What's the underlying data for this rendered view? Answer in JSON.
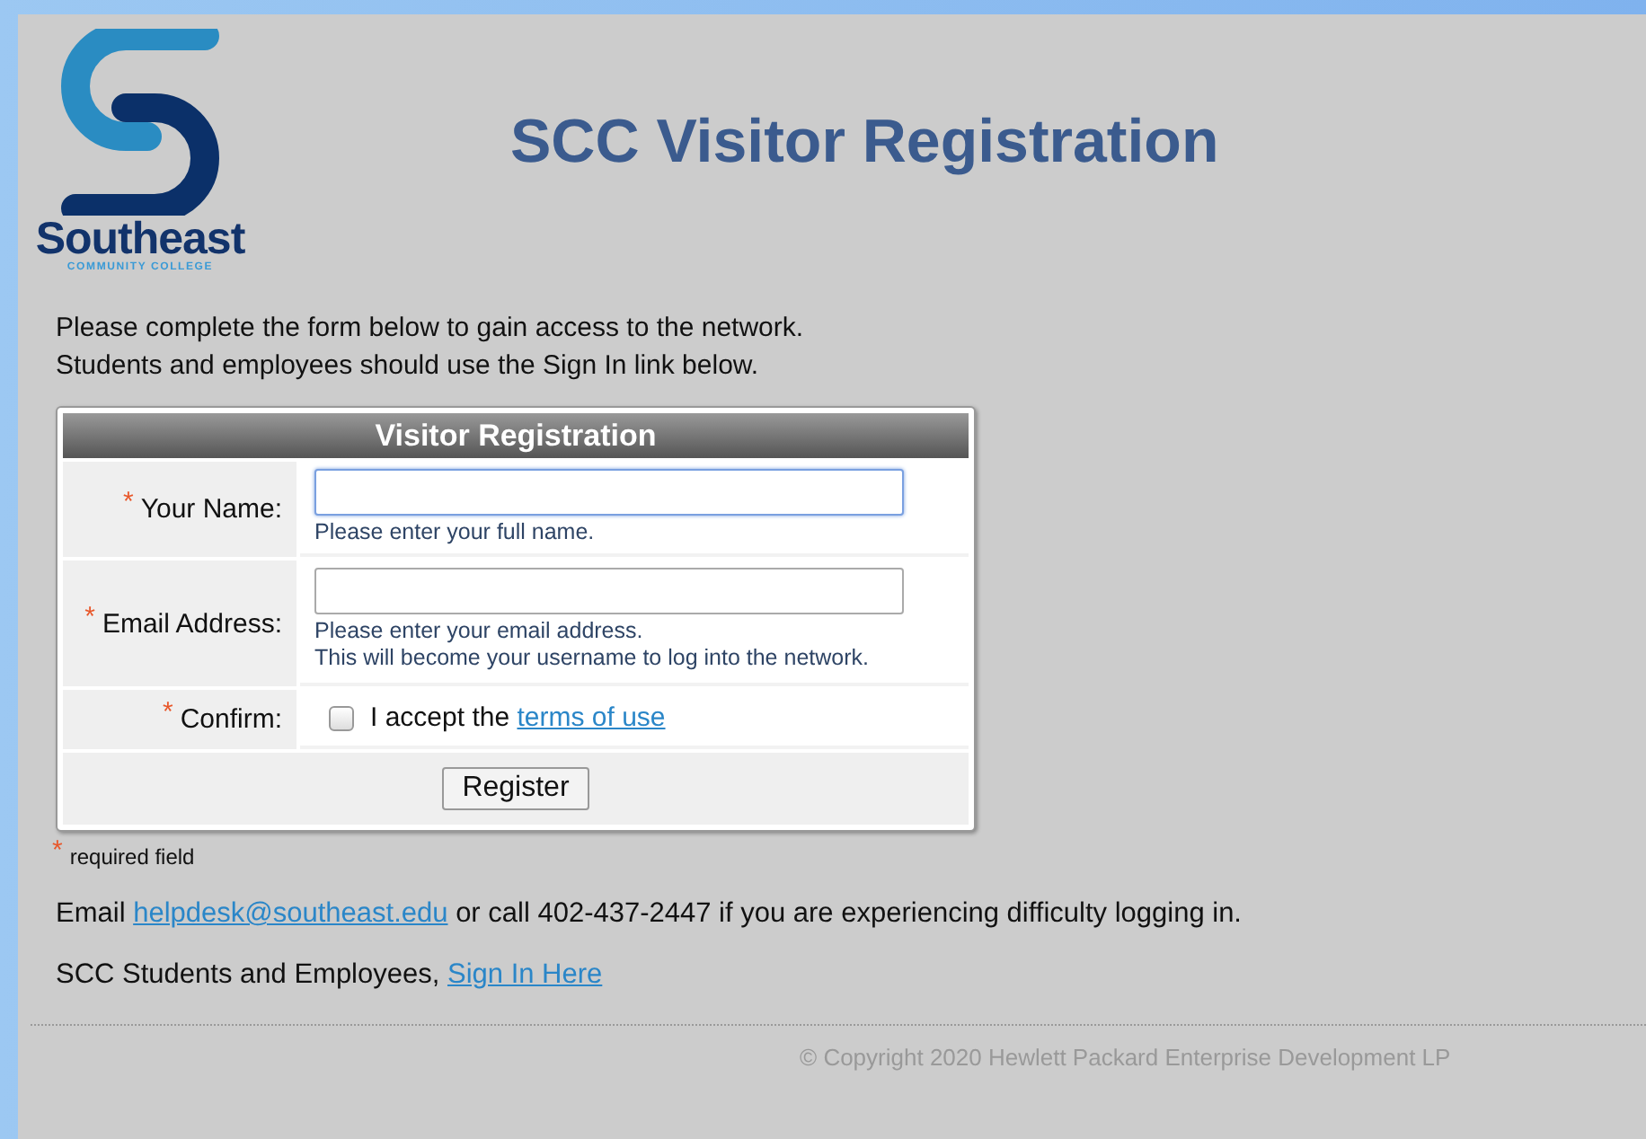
{
  "logo": {
    "name": "Southeast",
    "subtitle": "COMMUNITY COLLEGE"
  },
  "title": "SCC Visitor Registration",
  "intro": [
    "Please complete the form below to gain access to the network.",
    "Students and employees should use the Sign In link below."
  ],
  "form": {
    "title": "Visitor Registration",
    "fields": [
      {
        "kind": "text",
        "required_mark": "*",
        "label": "Your Name:",
        "focused": true,
        "hints": [
          "Please enter your full name."
        ]
      },
      {
        "kind": "text",
        "required_mark": "*",
        "label": "Email Address:",
        "focused": false,
        "hints": [
          "Please enter your email address.",
          "This will become your username to log into the network."
        ]
      },
      {
        "kind": "checkbox",
        "required_mark": "*",
        "label": "Confirm:",
        "checked": false,
        "text": "I accept the",
        "link": "terms of use"
      }
    ],
    "button": "Register"
  },
  "legend": {
    "mark": "*",
    "text": "required field"
  },
  "help": {
    "before": "Email",
    "link": "helpdesk@southeast.edu",
    "after": "or call 402-437-2447 if you are experiencing difficulty logging in."
  },
  "signin": {
    "before": "SCC Students and Employees,",
    "link": "Sign In Here"
  },
  "footer": "© Copyright 2020 Hewlett Packard Enterprise Development LP"
}
